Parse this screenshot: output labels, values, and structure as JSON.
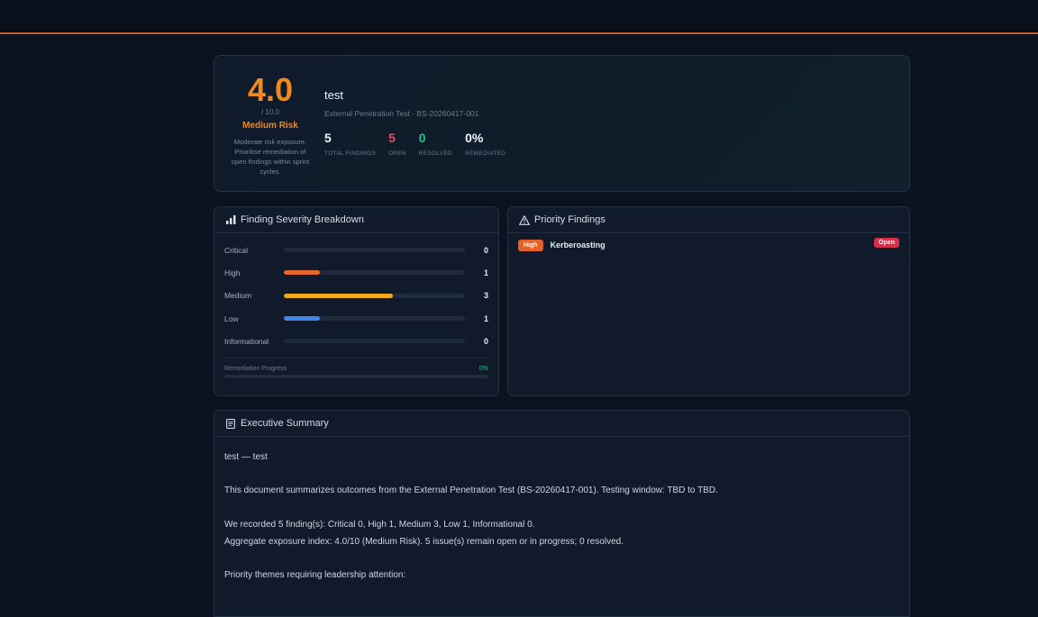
{
  "score": {
    "value": "4.0",
    "max": "/ 10.0",
    "level": "Medium Risk",
    "description": "Moderate risk exposure. Prioritise remediation of open findings within sprint cycles."
  },
  "engagement": {
    "title": "test",
    "subtitle": "External Penetration Test · BS-20260417-001"
  },
  "stats": [
    {
      "value": "5",
      "label": "TOTAL FINDINGS",
      "color": "#f0f3f7"
    },
    {
      "value": "5",
      "label": "OPEN",
      "color": "#ef4b5a"
    },
    {
      "value": "0",
      "label": "RESOLVED",
      "color": "#22c08a"
    },
    {
      "value": "0%",
      "label": "REMEDIATED",
      "color": "#f0f3f7"
    }
  ],
  "severity_panel": {
    "title": "Finding Severity Breakdown",
    "rows": [
      {
        "name": "Critical",
        "count": "0",
        "fraction": 0.0,
        "color": "#e53950"
      },
      {
        "name": "High",
        "count": "1",
        "fraction": 0.2,
        "color": "#e8682c"
      },
      {
        "name": "Medium",
        "count": "3",
        "fraction": 0.6,
        "color": "#f0a81d"
      },
      {
        "name": "Low",
        "count": "1",
        "fraction": 0.2,
        "color": "#3f86ee"
      },
      {
        "name": "Informational",
        "count": "0",
        "fraction": 0.0,
        "color": "#6b7a8f"
      }
    ],
    "remediation_label": "Remediation Progress",
    "remediation_value": "0%"
  },
  "priority_panel": {
    "title": "Priority Findings",
    "items": [
      {
        "severity": "High",
        "title": "Kerberoasting",
        "status": "Open"
      }
    ]
  },
  "summary_panel": {
    "title": "Executive Summary",
    "paragraphs": [
      "test — test",
      "",
      "This document summarizes outcomes from the External Penetration Test (BS-20260417-001). Testing window: TBD to TBD.",
      "",
      "We recorded 5 finding(s): Critical 0, High 1, Medium 3, Low 1, Informational 0.",
      "Aggregate exposure index: 4.0/10 (Medium Risk). 5 issue(s) remain open or in progress; 0 resolved.",
      "",
      "Priority themes requiring leadership attention:"
    ]
  }
}
